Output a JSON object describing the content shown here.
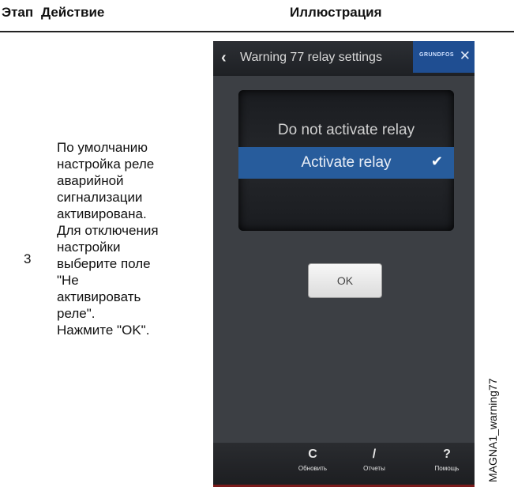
{
  "headers": {
    "step": "Этап",
    "action": "Действие",
    "illustration": "Иллюстрация"
  },
  "row": {
    "step": "3",
    "action_lines": [
      "По умолчанию",
      "настройка реле",
      "аварийной",
      "сигнализации",
      "активирована.",
      "Для отключения",
      "настройки",
      "выберите поле",
      "\"Не",
      "активировать",
      "реле\".",
      "Нажмите \"OK\"."
    ]
  },
  "side_label": "MAGNA1_warning77",
  "phone": {
    "title": "Warning 77 relay settings",
    "brand": "GRUNDFOS",
    "options": [
      "Do not activate relay",
      "Activate relay"
    ],
    "selected_index": 1,
    "ok_label": "OK",
    "tabs": [
      {
        "icon": "refresh-icon",
        "glyph": "C",
        "label": "Обновить"
      },
      {
        "icon": "pencil-icon",
        "glyph": "/",
        "label": "Отчеты"
      },
      {
        "icon": "help-icon",
        "glyph": "?",
        "label": "Помощь"
      }
    ]
  }
}
